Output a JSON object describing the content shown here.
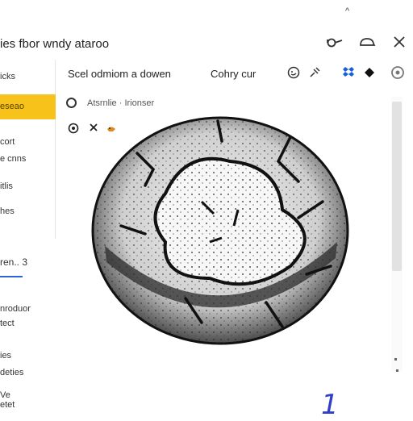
{
  "app": {
    "caret": "^",
    "title": "ies fbor wndy ataroo"
  },
  "header_icons": [
    "glasses-icon",
    "cap-icon",
    "close-icon"
  ],
  "sidebar": {
    "items": [
      {
        "label": "icks"
      },
      {
        "label": "eseao",
        "active": true
      },
      {
        "label": "cort"
      },
      {
        "label": "e cnns"
      },
      {
        "label": "itlis"
      },
      {
        "label": "hes"
      },
      {
        "label": "ren.. 3"
      },
      {
        "label": "nroduor"
      },
      {
        "label": "tect"
      },
      {
        "label": "ies"
      },
      {
        "label": "deties"
      },
      {
        "label": "Ve"
      },
      {
        "label": "etet"
      }
    ]
  },
  "toolbar": {
    "left_text": "Scel odmiom a dowen",
    "mid_text": "Cohry cur",
    "icons": [
      "smiley-icon",
      "pin-icon",
      "dropbox-icon",
      "diamond-icon",
      "circle-target-icon"
    ]
  },
  "content": {
    "breadcrumb": "Atsrnlie · Irionser",
    "row_icons": [
      "target-icon",
      "x-icon",
      "duck-icon"
    ]
  },
  "image": {
    "subject": "cracked-cookie-illustration"
  },
  "mark": "1",
  "colors": {
    "active_bg": "#f7c31a",
    "accent_blue": "#2d62d8",
    "dropbox_blue": "#1a5fd6"
  }
}
